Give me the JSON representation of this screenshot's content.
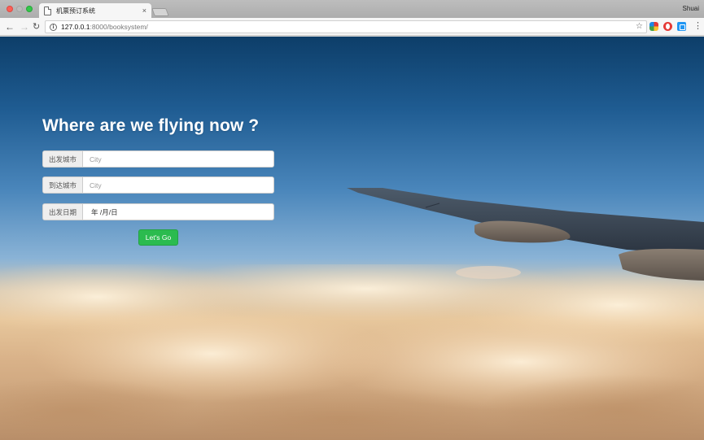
{
  "browser": {
    "tab_title": "机票预订系统",
    "tab_close": "×",
    "profile_name": "Shuai",
    "url_host": "127.0.0.1",
    "url_path": ":8000/booksystem/",
    "icons": {
      "back": "arrow-left",
      "forward": "arrow-right",
      "reload": "reload",
      "info": "info-circle",
      "star": "star",
      "menu": "vertical-dots"
    }
  },
  "page": {
    "title": "Where are we flying now ?",
    "fields": {
      "departure": {
        "label": "出发城市",
        "placeholder": "City",
        "value": ""
      },
      "arrival": {
        "label": "到达城市",
        "placeholder": "City",
        "value": ""
      },
      "date": {
        "label": "出发日期",
        "value": "年 /月/日"
      }
    },
    "submit_label": "Let's Go"
  },
  "colors": {
    "button_green": "#2bbb4f",
    "sky_top": "#0d3e69"
  }
}
